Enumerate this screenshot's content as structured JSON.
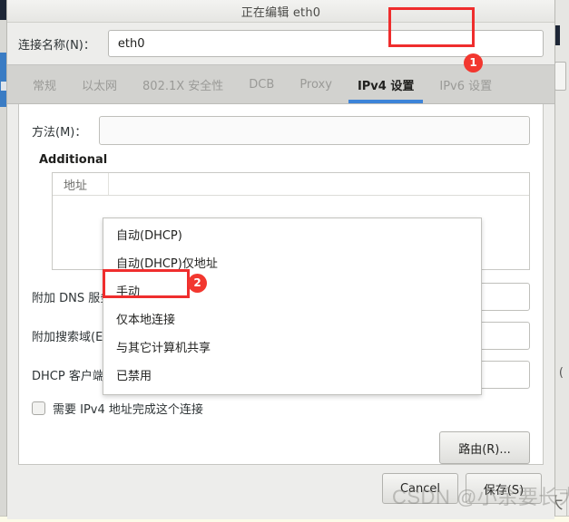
{
  "window": {
    "title": "正在编辑 eth0"
  },
  "connection": {
    "label": "连接名称(N)：",
    "value": "eth0",
    "placeholder": ""
  },
  "tabs": [
    {
      "label": "常规",
      "active": false
    },
    {
      "label": "以太网",
      "active": false
    },
    {
      "label": "802.1X 安全性",
      "active": false
    },
    {
      "label": "DCB",
      "active": false
    },
    {
      "label": "Proxy",
      "active": false
    },
    {
      "label": "IPv4 设置",
      "active": true
    },
    {
      "label": "IPv6 设置",
      "active": false
    }
  ],
  "ipv4": {
    "method_label": "方法(M)：",
    "additional_heading": "Additional",
    "address_table": {
      "columns": [
        "地址"
      ],
      "rows": []
    },
    "fields": [
      {
        "label": "附加 DNS 服务器：",
        "value": "",
        "placeholder": ""
      },
      {
        "label": "附加搜索域(E)：",
        "value": "",
        "placeholder": ""
      },
      {
        "label": "DHCP 客户端 ID：",
        "value": "",
        "placeholder": ""
      }
    ],
    "require_checkbox": {
      "label": "需要 IPv4 地址完成这个连接",
      "checked": false
    },
    "routes_button": "路由(R)..."
  },
  "method_dropdown": {
    "open": true,
    "options": [
      "自动(DHCP)",
      "自动(DHCP)仅地址",
      "手动",
      "仅本地连接",
      "与其它计算机共享",
      "已禁用"
    ],
    "highlighted": "手动"
  },
  "actions": {
    "cancel": "Cancel",
    "save": "保存(S)"
  },
  "annotations": [
    {
      "badge": "1",
      "target": "IPv4 设置"
    },
    {
      "badge": "2",
      "target": "手动"
    }
  ],
  "watermark": "CSDN @小余要长大",
  "colors": {
    "annotation_red": "#ef2d2d",
    "badge_red": "#f2372f",
    "active_tab_underline": "#3d84d8",
    "dialog_bg": "#ededeb",
    "tabstrip_bg": "#d2d2cf"
  }
}
